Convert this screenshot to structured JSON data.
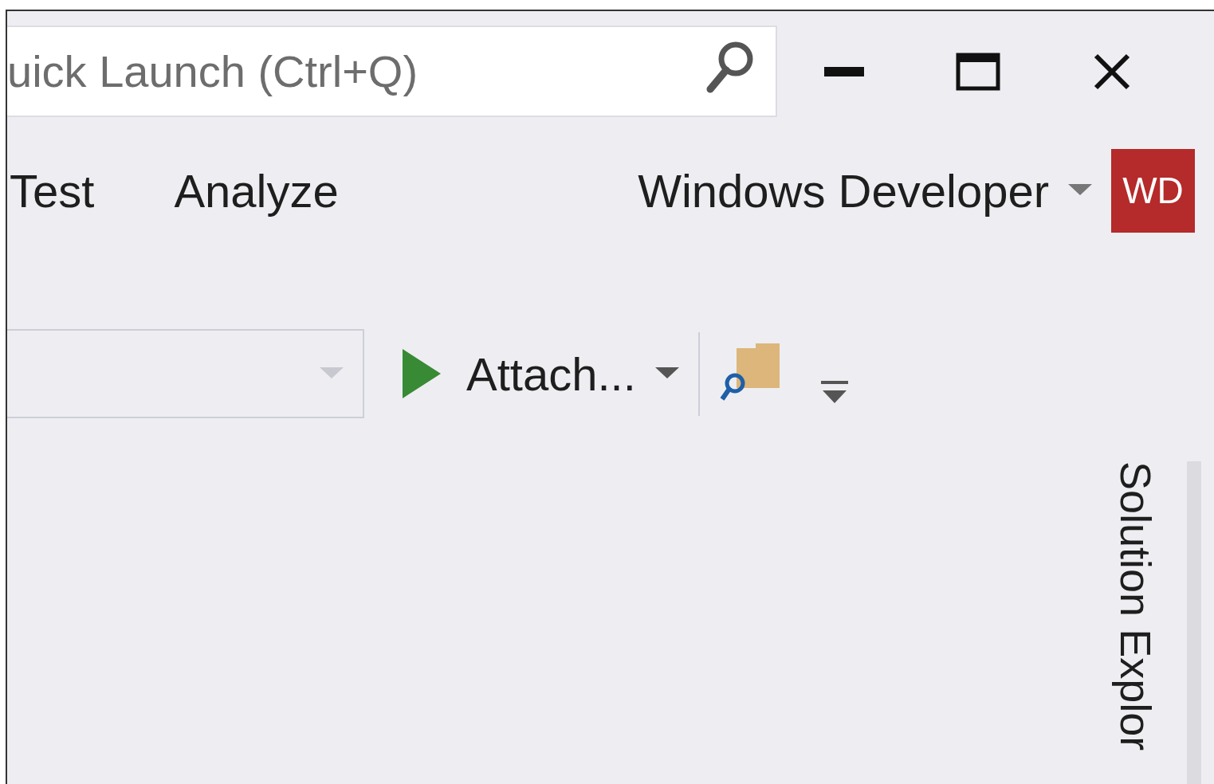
{
  "quick_launch": {
    "placeholder": "uick Launch (Ctrl+Q)"
  },
  "menu": [
    {
      "label": "Test"
    },
    {
      "label": "Analyze"
    }
  ],
  "account": {
    "name": "Windows Developer",
    "initials": "WD"
  },
  "toolbar": {
    "attach_label": "Attach..."
  },
  "side_tabs": [
    {
      "label": "Solution Explor"
    }
  ]
}
